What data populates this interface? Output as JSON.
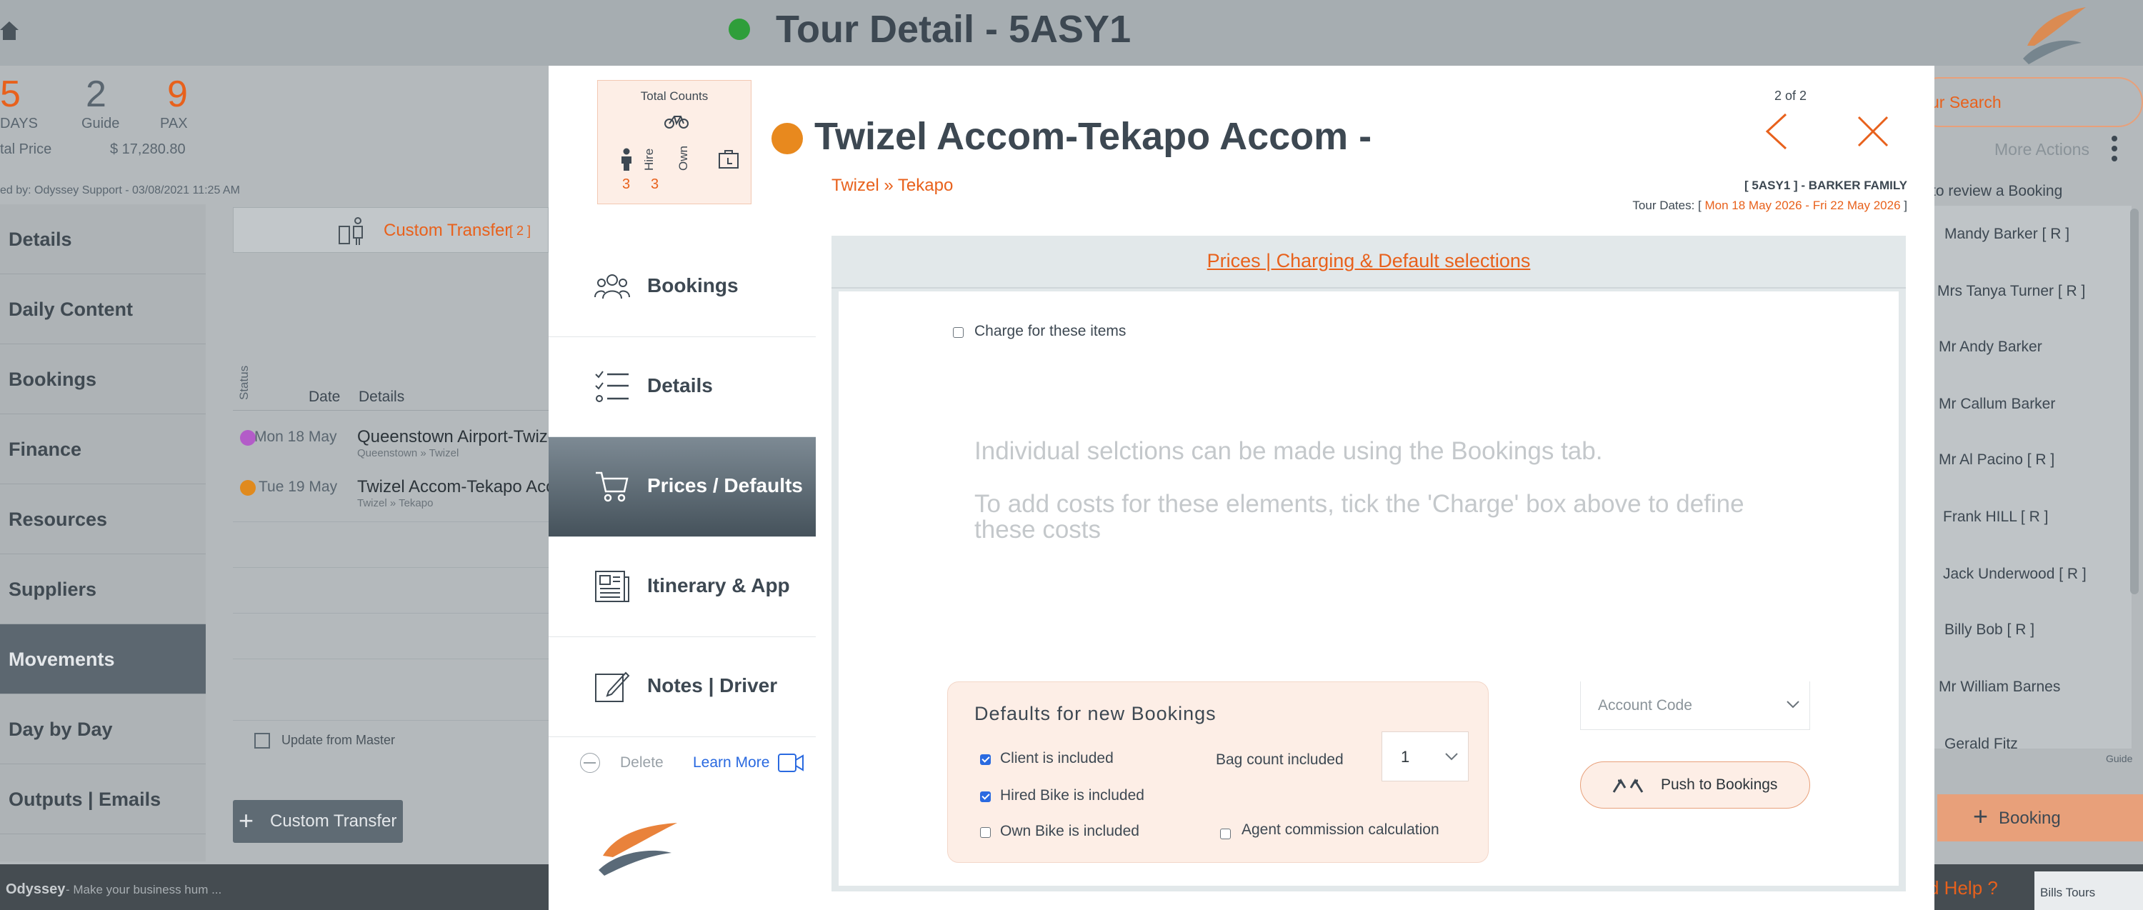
{
  "header": {
    "title": "Tour Detail - 5ASY1",
    "status_color": "#2f9e3a"
  },
  "summary": {
    "days_value": "5",
    "days_label": "DAYS",
    "guide_value": "2",
    "guide_label": "Guide",
    "pax_value": "9",
    "pax_label": "PAX",
    "total_price_label": "tal Price",
    "total_price_value": "$ 17,280.80",
    "created_by": "ed by: Odyssey Support - 03/08/2021 11:25 AM"
  },
  "sidebar": {
    "items": [
      {
        "label": "Details"
      },
      {
        "label": "Daily Content"
      },
      {
        "label": "Bookings"
      },
      {
        "label": "Finance"
      },
      {
        "label": "Resources"
      },
      {
        "label": "Suppliers"
      },
      {
        "label": "Movements"
      },
      {
        "label": "Day by Day"
      },
      {
        "label": "Outputs | Emails"
      }
    ],
    "active_index": 6
  },
  "movements": {
    "custom_transfer_label": "Custom Transfer",
    "custom_transfer_count": "[ 2 ]",
    "col_status": "Status",
    "col_date": "Date",
    "col_details": "Details",
    "rows": [
      {
        "date": "Mon 18 May",
        "details": "Queenstown Airport-Twize",
        "route": "Queenstown » Twizel",
        "dot_color": "#b35cc8"
      },
      {
        "date": "Tue 19 May",
        "details": "Twizel Accom-Tekapo Acc",
        "route": "Twizel » Tekapo",
        "dot_color": "#e08a1e"
      }
    ],
    "update_from_master": "Update from Master",
    "add_custom_transfer": "Custom Transfer"
  },
  "right_panel": {
    "search_placeholder": "ur Search",
    "more_actions": "More Actions",
    "hint": "to review a Booking",
    "people": [
      "Mandy Barker  [ R ]",
      "Mrs Tanya Turner  [ R ]",
      "Mr Andy Barker",
      "Mr Callum Barker",
      "Mr Al Pacino  [ R ]",
      "Frank HILL  [ R ]",
      "Jack Underwood  [ R ]",
      "Billy Bob  [ R ]",
      "Mr William Barnes",
      "Gerald Fitz"
    ],
    "guide_tag": "Guide",
    "add_booking_label": "Booking"
  },
  "footer": {
    "brand": "Odyssey",
    "tagline": " - Make your business hum ...",
    "help": "d Help ?",
    "partner_logo_text": "Bills Tours"
  },
  "modal": {
    "counts": {
      "title": "Total Counts",
      "hire_label": "Hire",
      "own_label": "Own",
      "person_count": "3",
      "hire_count": "3"
    },
    "status_color": "#e8891e",
    "title": "Twizel Accom-Tekapo Accom -",
    "route": "Twizel » Tekapo",
    "pager": "2 of 2",
    "tour_ref": "[ 5ASY1 ] - BARKER FAMILY",
    "tour_dates_label": "Tour Dates: [",
    "tour_dates_value": " Mon 18 May 2026 - Fri 22 May 2026 ",
    "tour_dates_close": "]",
    "nav": [
      {
        "label": "Bookings",
        "icon": "people-icon"
      },
      {
        "label": "Details",
        "icon": "checklist-icon"
      },
      {
        "label": "Prices / Defaults",
        "icon": "cart-icon"
      },
      {
        "label": "Itinerary & App",
        "icon": "newspaper-icon"
      },
      {
        "label": "Notes | Driver",
        "icon": "edit-note-icon"
      }
    ],
    "active_nav_index": 2,
    "delete_label": "Delete",
    "learn_more_label": "Learn More",
    "section_title": "Prices | Charging & Default selections",
    "charge_label": "Charge for these items",
    "charge_checked": false,
    "message_1": "Individual selctions can be made using the Bookings tab.",
    "message_2a": "To add costs for these elements, tick the 'Charge' box above to define",
    "message_2b": "these costs",
    "defaults": {
      "title": "Defaults for new Bookings",
      "client_included_label": "Client is included",
      "client_included": true,
      "hired_bike_label": "Hired Bike is included",
      "hired_bike": true,
      "own_bike_label": "Own  Bike is included",
      "own_bike": false,
      "bag_count_label": "Bag count included",
      "bag_count_value": "1",
      "agent_commission_label": "Agent commission calculation",
      "agent_commission": false
    },
    "account_code_placeholder": "Account Code",
    "push_button_label": "Push to Bookings"
  },
  "colors": {
    "accent_orange": "#e8611c",
    "nav_active": "#4f5b64",
    "text_dark": "#3d4852"
  }
}
